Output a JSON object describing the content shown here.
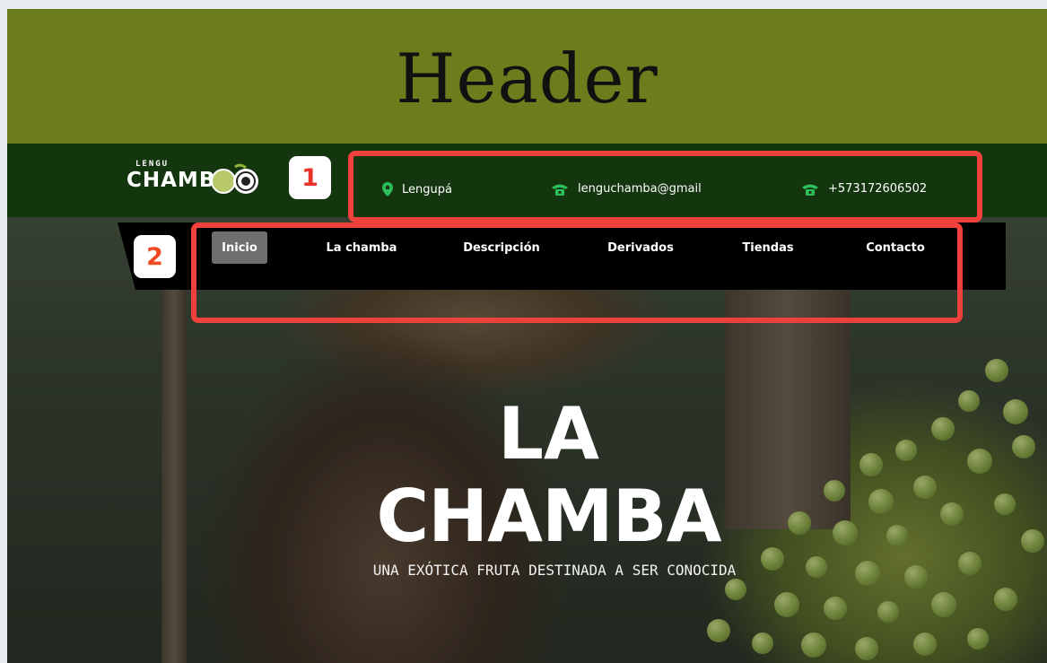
{
  "header": {
    "title": "Header"
  },
  "logo": {
    "top_text": "LENGU",
    "main_text": "CHAMBA"
  },
  "annotations": {
    "badge_one": "1",
    "badge_two": "2",
    "highlight_color": "#f0413d"
  },
  "contact": {
    "location": {
      "icon": "location-pin-icon",
      "text": "Lengupá"
    },
    "email": {
      "icon": "phone-icon",
      "text": "lenguchamba@gmail"
    },
    "phone": {
      "icon": "phone-icon",
      "text": "+573172606502"
    }
  },
  "nav": {
    "items": [
      {
        "label": "Inicio",
        "active": true
      },
      {
        "label": "La chamba"
      },
      {
        "label": "Descripción"
      },
      {
        "label": "Derivados"
      },
      {
        "label": "Tiendas"
      },
      {
        "label": "Contacto"
      }
    ]
  },
  "hero": {
    "title_line1": "LA",
    "title_line2": "CHAMBA",
    "subtitle": "UNA EXÓTICA FRUTA DESTINADA A SER CONOCIDA"
  },
  "colors": {
    "header_bg": "#6b7d1c",
    "topbar_bg": "#14360f",
    "nav_bg": "#000000",
    "icon_green": "#2fbf5a"
  }
}
